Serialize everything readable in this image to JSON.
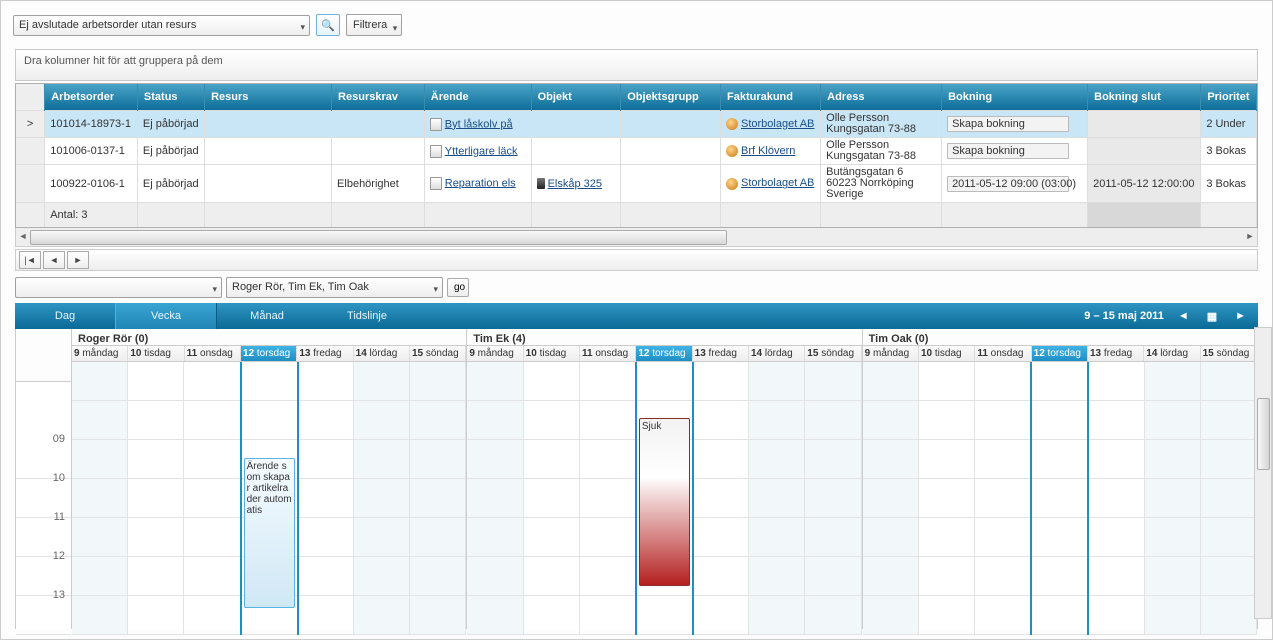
{
  "toolbar": {
    "filter_combo": "Ej avslutade arbetsorder utan resurs",
    "filter_btn": "Filtrera"
  },
  "groupbar_hint": "Dra kolumner hit för att gruppera på dem",
  "grid": {
    "headers": {
      "arbetsorder": "Arbetsorder",
      "status": "Status",
      "resurs": "Resurs",
      "resurskrav": "Resurskrav",
      "arende": "Ärende",
      "objekt": "Objekt",
      "objektsgrupp": "Objektsgrupp",
      "fakturakund": "Fakturakund",
      "adress": "Adress",
      "bokning": "Bokning",
      "bokning_slut": "Bokning slut",
      "prioritet": "Prioritet"
    },
    "rows": [
      {
        "arbetsorder": "101014-18973-1",
        "status": "Ej påbörjad",
        "resurs": "",
        "resurskrav": "",
        "arende": "Byt låskolv på",
        "objekt": "",
        "objektsgrupp": "",
        "fakturakund": "Storbolaget AB",
        "adress": "Olle Persson Kungsgatan 73-88",
        "bokning": "Skapa bokning",
        "bokning_slut": "",
        "prioritet": "2 Under"
      },
      {
        "arbetsorder": "101006-0137-1",
        "status": "Ej påbörjad",
        "resurs": "",
        "resurskrav": "",
        "arende": "Ytterligare läck",
        "objekt": "",
        "objektsgrupp": "",
        "fakturakund": "Brf Klövern",
        "adress": "Olle Persson Kungsgatan 73-88",
        "bokning": "Skapa bokning",
        "bokning_slut": "",
        "prioritet": "3 Bokas"
      },
      {
        "arbetsorder": "100922-0106-1",
        "status": "Ej påbörjad",
        "resurs": "",
        "resurskrav": "Elbehörighet",
        "arende": "Reparation els",
        "objekt": "Elskåp 325",
        "objektsgrupp": "",
        "fakturakund": "Storbolaget AB",
        "adress": "Butängsgatan 6 60223 Norrköping Sverige",
        "bokning": "2011-05-12 09:00 (03:00)",
        "bokning_slut": "2011-05-12 12:00:00",
        "prioritet": "3 Bokas"
      }
    ],
    "total_label": "Antal: 3"
  },
  "resource_filter": {
    "value": "Roger Rör, Tim Ek, Tim Oak",
    "go": "go",
    "empty": ""
  },
  "tabs": {
    "day": "Dag",
    "week": "Vecka",
    "month": "Månad",
    "timeline": "Tidslinje"
  },
  "date_range": "9 – 15 maj 2011",
  "resources": [
    {
      "label": "Roger Rör (0)"
    },
    {
      "label": "Tim Ek (4)"
    },
    {
      "label": "Tim Oak (0)"
    }
  ],
  "days": [
    {
      "num": "9",
      "name": "måndag"
    },
    {
      "num": "10",
      "name": "tisdag"
    },
    {
      "num": "11",
      "name": "onsdag"
    },
    {
      "num": "12",
      "name": "torsdag"
    },
    {
      "num": "13",
      "name": "fredag"
    },
    {
      "num": "14",
      "name": "lördag"
    },
    {
      "num": "15",
      "name": "söndag"
    }
  ],
  "hours": [
    "09",
    "10",
    "11",
    "12",
    "13"
  ],
  "events": {
    "roger_thu": {
      "text": "Ärende som skapar artikelrader automatis"
    },
    "tim_thu": {
      "text": "Sjuk"
    }
  }
}
